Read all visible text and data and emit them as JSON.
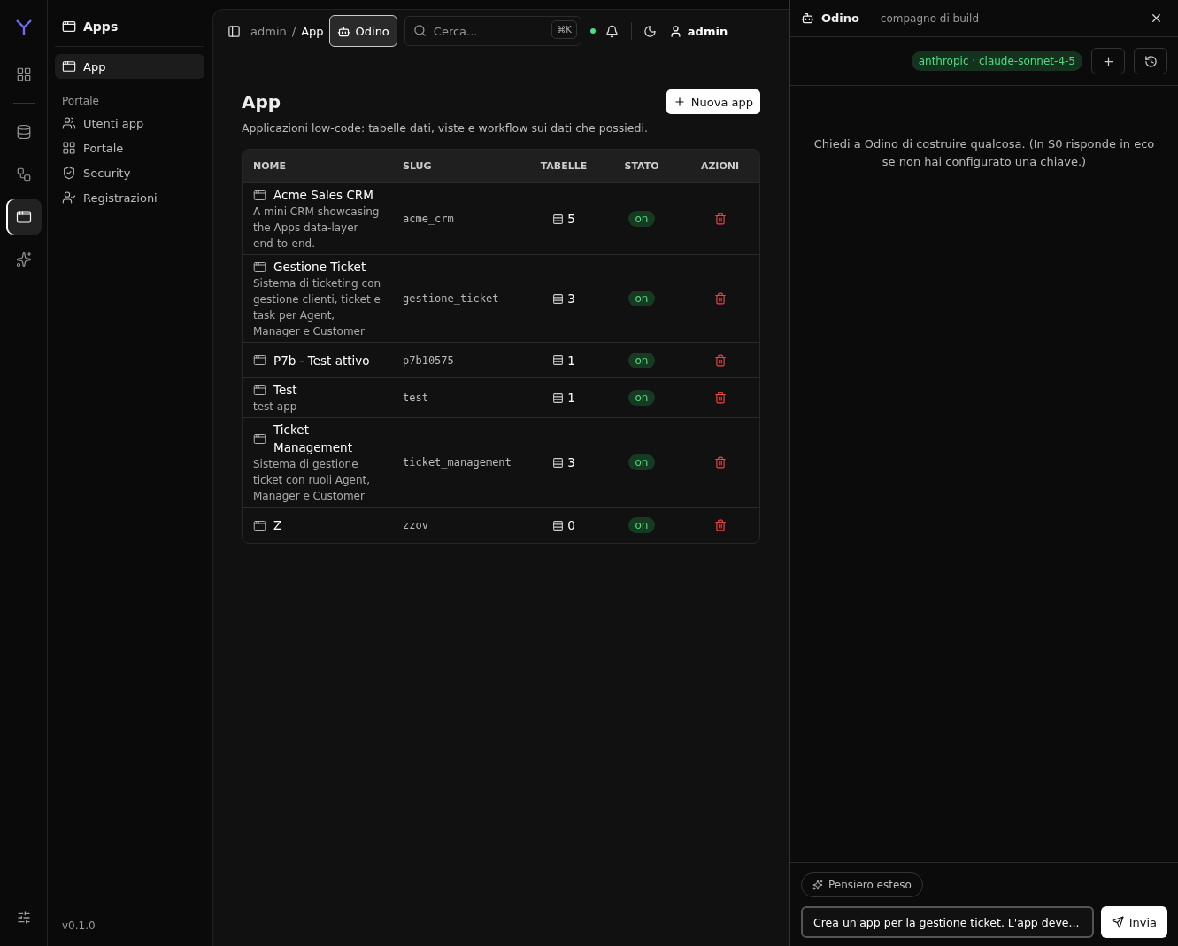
{
  "rail": {
    "items": [
      {
        "selected": false
      },
      {
        "selected": false
      },
      {
        "selected": false
      },
      {
        "selected": true
      },
      {
        "selected": false
      }
    ]
  },
  "sidebar": {
    "title": "Apps",
    "items": [
      {
        "label": "App",
        "selected": true
      }
    ],
    "section": "Portale",
    "section_items": [
      {
        "label": "Utenti app",
        "selected": false
      },
      {
        "label": "Portale",
        "selected": false
      },
      {
        "label": "Security",
        "selected": false
      },
      {
        "label": "Registrazioni",
        "selected": false
      }
    ],
    "version": "v0.1.0"
  },
  "topbar": {
    "breadcrumb": [
      "admin",
      "App"
    ],
    "breadcrumb_separator": "/",
    "odino_button": "Odino",
    "search": {
      "placeholder": "Cerca...",
      "shortcut": "⌘K"
    },
    "user": "admin"
  },
  "page": {
    "title": "App",
    "new_button": "Nuova app",
    "subtitle": "Applicazioni low-code: tabelle dati, viste e workflow sui dati che possiedi."
  },
  "table": {
    "columns": [
      "NOME",
      "SLUG",
      "TABELLE",
      "STATO",
      "AZIONI"
    ],
    "rows": [
      {
        "name": "Acme Sales CRM",
        "description": "A mini CRM showcasing the Apps data-layer end-to-end.",
        "slug": "acme_crm",
        "tables": "5",
        "status": "on"
      },
      {
        "name": "Gestione Ticket",
        "description": "Sistema di ticketing con gestione clienti, ticket e task per Agent, Manager e Customer",
        "slug": "gestione_ticket",
        "tables": "3",
        "status": "on"
      },
      {
        "name": "P7b - Test attivo",
        "slug": "p7b10575",
        "tables": "1",
        "status": "on"
      },
      {
        "name": "Test",
        "description": "test app",
        "slug": "test",
        "tables": "1",
        "status": "on"
      },
      {
        "name": "Ticket Management",
        "description": "Sistema di gestione ticket con ruoli Agent, Manager e Customer",
        "slug": "ticket_management",
        "tables": "3",
        "status": "on"
      },
      {
        "name": "Z",
        "slug": "zzov",
        "tables": "0",
        "status": "on"
      }
    ]
  },
  "assistant": {
    "title": "Odino",
    "subtitle": "— compagno di build",
    "model": "anthropic · claude-sonnet-4-5",
    "empty_message": "Chiedi a Odino di costruire qualcosa. (In S0 risponde in eco se non hai configurato una chiave.)",
    "thinking_button": "Pensiero esteso",
    "input_value": "Crea un'app per la gestione ticket. L'app deve...",
    "send_button": "Invia"
  }
}
